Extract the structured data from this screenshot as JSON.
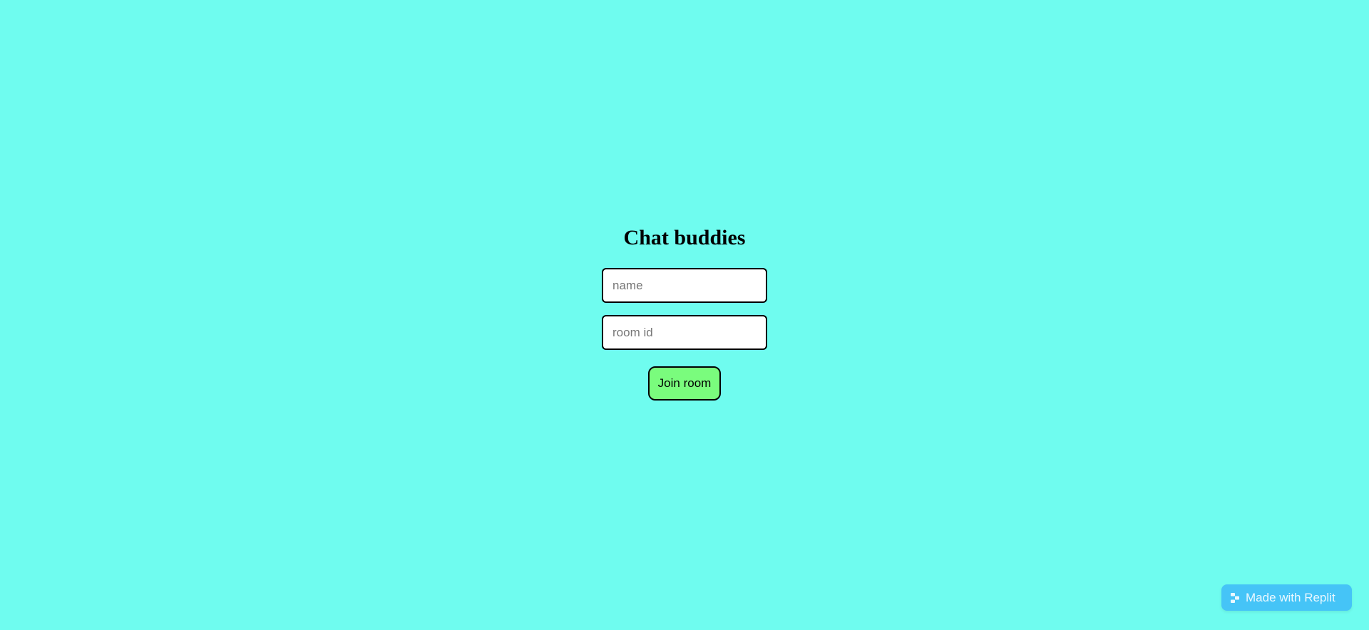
{
  "page": {
    "title": "Chat buddies"
  },
  "form": {
    "name_placeholder": "name",
    "name_value": "",
    "room_placeholder": "room id",
    "room_value": "",
    "join_label": "Join room"
  },
  "badge": {
    "label": "Made with Replit",
    "icon": "replit-icon"
  },
  "colors": {
    "background": "#6ffcef",
    "button": "#7afc7d",
    "badge": "#45c4f7"
  }
}
